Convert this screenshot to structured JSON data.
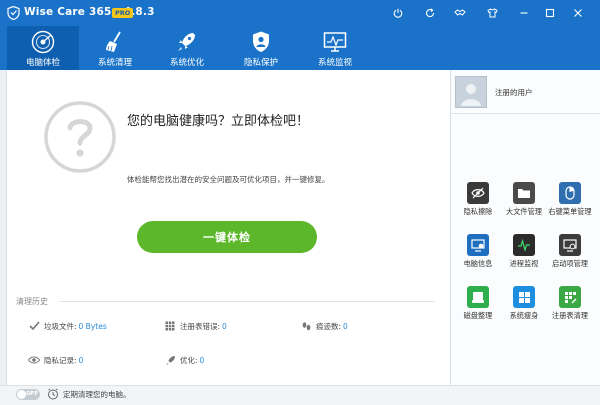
{
  "window": {
    "title": "Wise Care 365 - 4.8.3",
    "badge": "PRO"
  },
  "nav": {
    "items": [
      {
        "label": "电脑体检",
        "icon": "radar-icon",
        "active": true
      },
      {
        "label": "系统清理",
        "icon": "broom-icon",
        "active": false
      },
      {
        "label": "系统优化",
        "icon": "rocket-icon",
        "active": false
      },
      {
        "label": "隐私保护",
        "icon": "shield-user-icon",
        "active": false
      },
      {
        "label": "系统监视",
        "icon": "monitor-icon",
        "active": false
      }
    ]
  },
  "main": {
    "headline": "您的电脑健康吗？立即体检吧！",
    "description": "体检能帮您找出潜在的安全问题及可优化项目，并一键修复。",
    "check_button": "一键体检",
    "history_title": "清理历史",
    "stats": {
      "junk_label": "垃圾文件:",
      "junk_value": "0 Bytes",
      "registry_label": "注册表错误:",
      "registry_value": "0",
      "traces_label": "痕迹数:",
      "traces_value": "0",
      "privacy_label": "隐私记录:",
      "privacy_value": "0",
      "optimize_label": "优化:",
      "optimize_value": "0"
    }
  },
  "user": {
    "name": "注册的用户"
  },
  "tools": [
    {
      "label": "隐私擦除",
      "icon": "eye-slash-icon",
      "color": "#3a3a3a"
    },
    {
      "label": "大文件管理",
      "icon": "folder-icon",
      "color": "#4a4a4a"
    },
    {
      "label": "右键菜单管理",
      "icon": "mouse-icon",
      "color": "#2f6fb0"
    },
    {
      "label": "电脑信息",
      "icon": "pc-info-icon",
      "color": "#1f6fc0"
    },
    {
      "label": "进程监视",
      "icon": "process-icon",
      "color": "#2b2b2b"
    },
    {
      "label": "启动项管理",
      "icon": "startup-icon",
      "color": "#3c3c3c"
    },
    {
      "label": "磁盘整理",
      "icon": "disk-icon",
      "color": "#2fae4e"
    },
    {
      "label": "系统瘦身",
      "icon": "windows-icon",
      "color": "#1e8ee0"
    },
    {
      "label": "注册表清理",
      "icon": "registry-icon",
      "color": "#3aa845"
    }
  ],
  "status": {
    "toggle": "OFF",
    "text": "定期清理您的电脑。"
  },
  "colors": {
    "header_blue": "#1a73c8",
    "active_tab": "#0f5fb0",
    "button_green": "#5cb82a",
    "value_blue": "#2a8bd8"
  }
}
